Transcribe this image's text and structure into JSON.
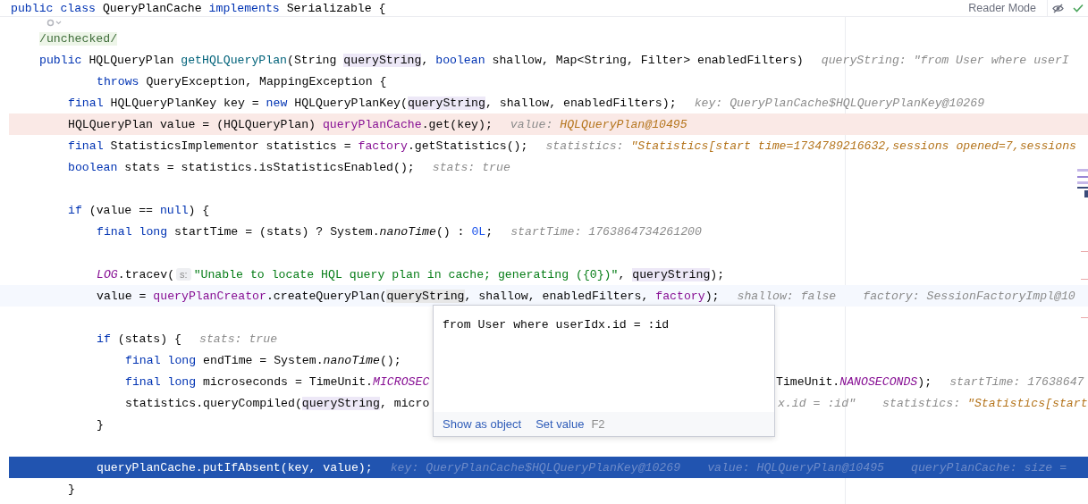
{
  "sticky_line": {
    "tokens": [
      {
        "kind": "kw",
        "t": "public class "
      },
      {
        "kind": "plain",
        "t": "QueryPlanCache "
      },
      {
        "kind": "kw",
        "t": "implements "
      },
      {
        "kind": "plain",
        "t": "Serializable {"
      }
    ]
  },
  "toolbar": {
    "reader_mode": "Reader Mode"
  },
  "lines": [
    {
      "tokens": [
        {
          "kind": "annotation",
          "t": "/unchecked/"
        }
      ]
    },
    {
      "tokens": [
        {
          "kind": "kw",
          "t": "public "
        },
        {
          "kind": "plain",
          "t": "HQLQueryPlan "
        },
        {
          "kind": "decl",
          "t": "getHQLQueryPlan"
        },
        {
          "kind": "plain",
          "t": "(String "
        },
        {
          "kind": "param",
          "t": "queryString"
        },
        {
          "kind": "plain",
          "t": ", "
        },
        {
          "kind": "kw",
          "t": "boolean "
        },
        {
          "kind": "plain",
          "t": "shallow, Map<String, Filter> enabledFilters)"
        }
      ],
      "hints": [
        {
          "label": "queryString:",
          "value": "\"from User where userI",
          "kind": "plain"
        }
      ],
      "children": [
        {
          "kind": "continuation",
          "tokens": [
            {
              "kind": "kw",
              "t": "throws "
            },
            {
              "kind": "plain",
              "t": "QueryException, MappingException {"
            }
          ]
        },
        {
          "tokens": [
            {
              "kind": "kw",
              "t": "final "
            },
            {
              "kind": "plain",
              "t": "HQLQueryPlanKey key = "
            },
            {
              "kind": "kw",
              "t": "new "
            },
            {
              "kind": "plain",
              "t": "HQLQueryPlanKey("
            },
            {
              "kind": "param",
              "t": "queryString"
            },
            {
              "kind": "plain",
              "t": ", shallow, enabledFilters);"
            }
          ],
          "hints": [
            {
              "label": "key:",
              "value": "QueryPlanCache$HQLQueryPlanKey@10269",
              "kind": "plain"
            }
          ]
        },
        {
          "breakpoint": true,
          "tokens": [
            {
              "kind": "plain",
              "t": "HQLQueryPlan value = (HQLQueryPlan) "
            },
            {
              "kind": "field",
              "t": "queryPlanCache"
            },
            {
              "kind": "plain",
              "t": ".get(key);"
            }
          ],
          "hints": [
            {
              "label": "value:",
              "value": "HQLQueryPlan@10495",
              "kind": "value"
            }
          ]
        },
        {
          "tokens": [
            {
              "kind": "kw",
              "t": "final "
            },
            {
              "kind": "plain",
              "t": "StatisticsImplementor statistics = "
            },
            {
              "kind": "field",
              "t": "factory"
            },
            {
              "kind": "plain",
              "t": ".getStatistics();"
            }
          ],
          "hints": [
            {
              "label": "statistics:",
              "value": "\"Statistics[start time=1734789216632,sessions opened=7,sessions",
              "kind": "value"
            }
          ]
        },
        {
          "tokens": [
            {
              "kind": "kw",
              "t": "boolean "
            },
            {
              "kind": "plain",
              "t": "stats = statistics.isStatisticsEnabled();"
            }
          ],
          "hints": [
            {
              "label": "stats:",
              "value": "true",
              "kind": "plain"
            }
          ]
        },
        {
          "blank_line_before": true,
          "tokens": [
            {
              "kind": "kw",
              "t": "if "
            },
            {
              "kind": "plain",
              "t": "(value == "
            },
            {
              "kind": "kw",
              "t": "null"
            },
            {
              "kind": "plain",
              "t": ") {"
            }
          ],
          "children": [
            {
              "tokens": [
                {
                  "kind": "kw",
                  "t": "final long "
                },
                {
                  "kind": "plain",
                  "t": "startTime = (stats) ? System."
                },
                {
                  "kind": "italic",
                  "t": "nanoTime"
                },
                {
                  "kind": "plain",
                  "t": "() : "
                },
                {
                  "kind": "num",
                  "t": "0L"
                },
                {
                  "kind": "plain",
                  "t": ";"
                }
              ],
              "hints": [
                {
                  "label": "startTime:",
                  "value": "1763864734261200",
                  "kind": "plain"
                }
              ]
            },
            {
              "blank_line_before": true,
              "tokens": [
                {
                  "kind": "static",
                  "t": "LOG"
                },
                {
                  "kind": "plain",
                  "t": ".tracev("
                },
                {
                  "kind": "chip",
                  "t": "s:"
                },
                {
                  "kind": "str",
                  "t": "\"Unable to locate HQL query plan in cache; generating ({0})\""
                },
                {
                  "kind": "plain",
                  "t": ", "
                },
                {
                  "kind": "param",
                  "t": "queryString"
                },
                {
                  "kind": "plain",
                  "t": ");"
                }
              ]
            },
            {
              "current_line": true,
              "tokens": [
                {
                  "kind": "plain",
                  "t": "value = "
                },
                {
                  "kind": "field",
                  "t": "queryPlanCreator"
                },
                {
                  "kind": "plain",
                  "t": ".createQueryPlan("
                },
                {
                  "kind": "usage",
                  "t": "queryString"
                },
                {
                  "kind": "plain",
                  "t": ", shallow, enabledFilters, "
                },
                {
                  "kind": "field",
                  "t": "factory"
                },
                {
                  "kind": "plain",
                  "t": ");"
                }
              ],
              "hints": [
                {
                  "label": "shallow:",
                  "value": "false",
                  "kind": "plain"
                },
                {
                  "label": "factory:",
                  "value": "SessionFactoryImpl@10",
                  "kind": "plain"
                }
              ]
            },
            {
              "blank_line_before": true,
              "tokens": [
                {
                  "kind": "kw",
                  "t": "if "
                },
                {
                  "kind": "plain",
                  "t": "(stats) {"
                }
              ],
              "hints": [
                {
                  "label": "stats:",
                  "value": "true",
                  "kind": "plain"
                }
              ],
              "children": [
                {
                  "tokens": [
                    {
                      "kind": "kw",
                      "t": "final long "
                    },
                    {
                      "kind": "plain",
                      "t": "endTime = System."
                    },
                    {
                      "kind": "italic",
                      "t": "nanoTime"
                    },
                    {
                      "kind": "plain",
                      "t": "();"
                    }
                  ]
                },
                {
                  "tokens": [
                    {
                      "kind": "kw",
                      "t": "final long "
                    },
                    {
                      "kind": "plain",
                      "t": "microseconds = TimeUnit."
                    },
                    {
                      "kind": "static",
                      "t": "MICROSEC"
                    }
                  ],
                  "tail_tokens": [
                    {
                      "kind": "plain",
                      "t": "TimeUnit."
                    },
                    {
                      "kind": "static",
                      "t": "NANOSECONDS"
                    },
                    {
                      "kind": "plain",
                      "t": ");"
                    }
                  ],
                  "tail_hints": [
                    {
                      "label": "startTime:",
                      "value": "17638647",
                      "kind": "plain"
                    }
                  ]
                },
                {
                  "tokens": [
                    {
                      "kind": "plain",
                      "t": "statistics.queryCompiled("
                    },
                    {
                      "kind": "param",
                      "t": "queryString"
                    },
                    {
                      "kind": "plain",
                      "t": ", micro"
                    }
                  ],
                  "tail_hints": [
                    {
                      "value": "x.id = :id\"",
                      "kind": "plain"
                    },
                    {
                      "label": "statistics:",
                      "value": "\"Statistics[start",
                      "kind": "value"
                    }
                  ]
                }
              ]
            },
            {
              "tokens": [
                {
                  "kind": "plain",
                  "t": "}"
                }
              ]
            },
            {
              "blank_line_before": true,
              "execution_point": true,
              "tokens": [
                {
                  "kind": "plain",
                  "t": "queryPlanCache.putIfAbsent(key, value);"
                }
              ],
              "hints": [
                {
                  "label": "key:",
                  "value": "QueryPlanCache$HQLQueryPlanKey@10269",
                  "kind": "plain"
                },
                {
                  "label": "value:",
                  "value": "HQLQueryPlan@10495",
                  "kind": "plain"
                },
                {
                  "label": "queryPlanCache:",
                  "value": "size =",
                  "kind": "plain"
                }
              ]
            }
          ]
        },
        {
          "tokens": [
            {
              "kind": "plain",
              "t": "}"
            }
          ]
        }
      ]
    }
  ],
  "popup": {
    "value": "from User where userIdx.id = :id",
    "actions": [
      {
        "label": "Show as object"
      },
      {
        "label": "Set value",
        "shortcut": "F2"
      }
    ]
  }
}
